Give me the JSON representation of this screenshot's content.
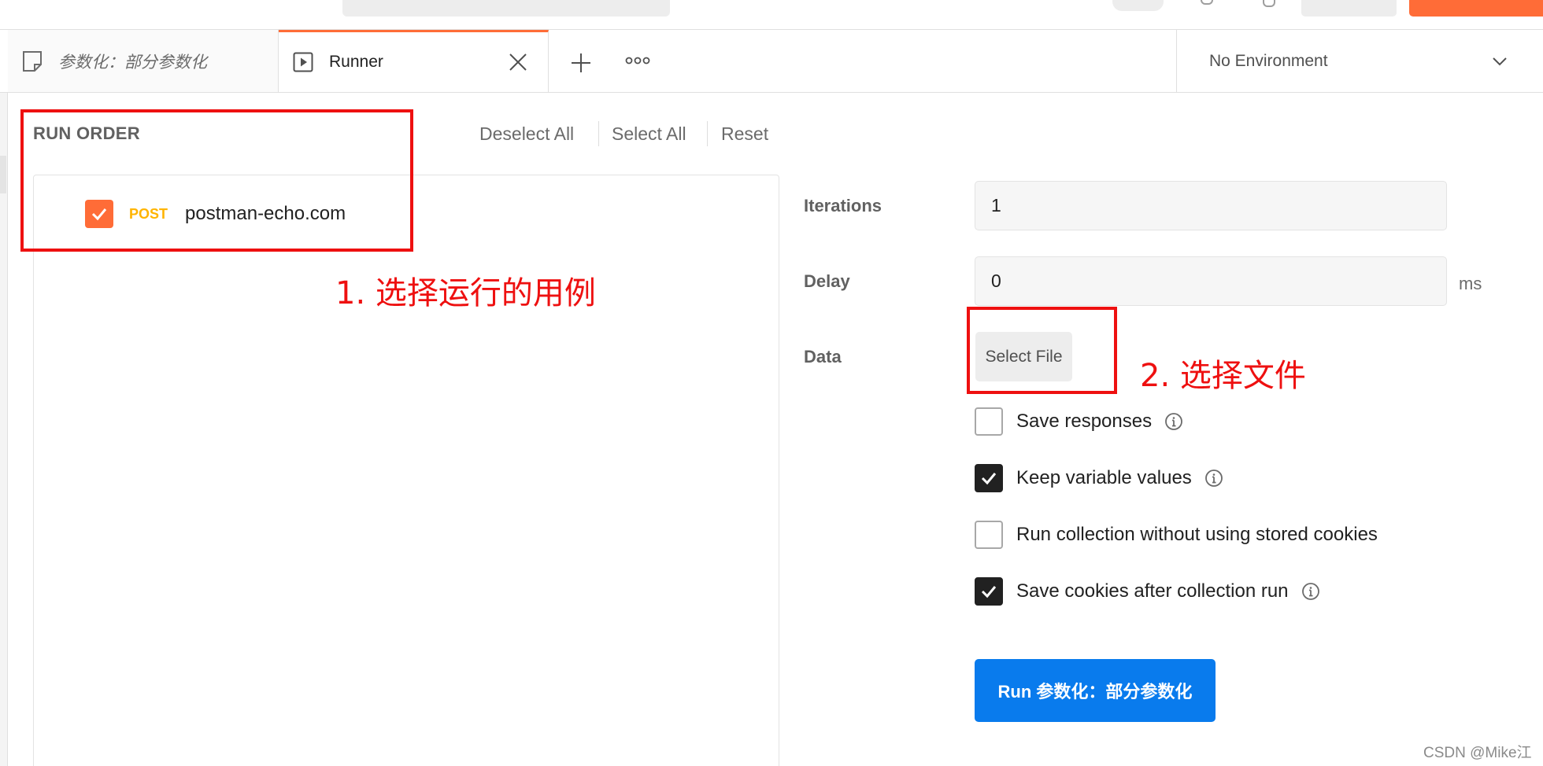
{
  "tabs": [
    {
      "label": "参数化：部分参数化",
      "icon": "request-doc-icon",
      "active": false
    },
    {
      "label": "Runner",
      "icon": "runner-play-icon",
      "active": true
    }
  ],
  "environment": {
    "selected": "No Environment"
  },
  "run_order": {
    "title": "RUN ORDER",
    "deselect_all": "Deselect All",
    "select_all": "Select All",
    "reset": "Reset",
    "requests": [
      {
        "method": "POST",
        "name": "postman-echo.com",
        "checked": true
      }
    ]
  },
  "settings": {
    "iterations_label": "Iterations",
    "iterations_value": "1",
    "delay_label": "Delay",
    "delay_value": "0",
    "delay_unit": "ms",
    "data_label": "Data",
    "select_file": "Select File",
    "options": [
      {
        "label": "Save responses",
        "checked": false,
        "info": true
      },
      {
        "label": "Keep variable values",
        "checked": true,
        "info": true
      },
      {
        "label": "Run collection without using stored cookies",
        "checked": false,
        "info": false
      },
      {
        "label": "Save cookies after collection run",
        "checked": true,
        "info": true
      }
    ],
    "run_button": "Run 参数化：部分参数化"
  },
  "annotations": {
    "step1": "1. 选择运行的用例",
    "step2": "2. 选择文件"
  },
  "watermark": "CSDN @Mike江",
  "colors": {
    "accent_orange": "#ff6c37",
    "run_blue": "#097bed",
    "post_method": "#ffb400",
    "annotation_red": "#ee1010"
  }
}
